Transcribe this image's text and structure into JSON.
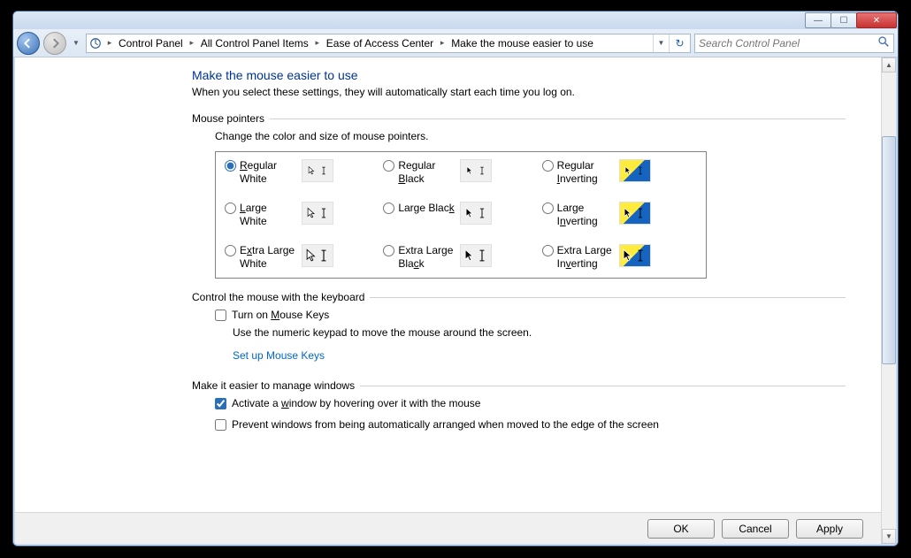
{
  "breadcrumbs": [
    "Control Panel",
    "All Control Panel Items",
    "Ease of Access Center",
    "Make the mouse easier to use"
  ],
  "search": {
    "placeholder": "Search Control Panel"
  },
  "page": {
    "title": "Make the mouse easier to use",
    "subtitle": "When you select these settings, they will automatically start each time you log on."
  },
  "pointers": {
    "header": "Mouse pointers",
    "sub": "Change the color and size of mouse pointers.",
    "options": [
      {
        "label_html": "<u>R</u>egular White",
        "style": "white",
        "size": "s",
        "checked": true
      },
      {
        "label_html": "Regular <u>B</u>lack",
        "style": "black",
        "size": "s",
        "checked": false
      },
      {
        "label_html": "Regular <u>I</u>nverting",
        "style": "inv",
        "size": "s",
        "checked": false
      },
      {
        "label_html": "<u>L</u>arge White",
        "style": "white",
        "size": "m",
        "checked": false
      },
      {
        "label_html": "Large Blac<u>k</u>",
        "style": "black",
        "size": "m",
        "checked": false
      },
      {
        "label_html": "Large I<u>n</u>verting",
        "style": "inv",
        "size": "m",
        "checked": false
      },
      {
        "label_html": "E<u>x</u>tra Large White",
        "style": "white",
        "size": "l",
        "checked": false
      },
      {
        "label_html": "Extra Large Bla<u>c</u>k",
        "style": "black",
        "size": "l",
        "checked": false
      },
      {
        "label_html": "Extra Large In<u>v</u>erting",
        "style": "inv",
        "size": "l",
        "checked": false
      }
    ]
  },
  "keyboard": {
    "header": "Control the mouse with the keyboard",
    "mousekeys_label_html": "Turn on <u>M</u>ouse Keys",
    "mousekeys_checked": false,
    "mousekeys_desc": "Use the numeric keypad to move the mouse around the screen.",
    "setup_link": "Set up Mouse Keys"
  },
  "windows": {
    "header": "Make it easier to manage windows",
    "hover_label_html": "Activate a <u>w</u>indow by hovering over it with the mouse",
    "hover_checked": true,
    "arrange_label_html": "Prevent windows from being automatically arranged when moved to the edge of the screen",
    "arrange_checked": false
  },
  "buttons": {
    "ok": "OK",
    "cancel": "Cancel",
    "apply": "Apply"
  }
}
